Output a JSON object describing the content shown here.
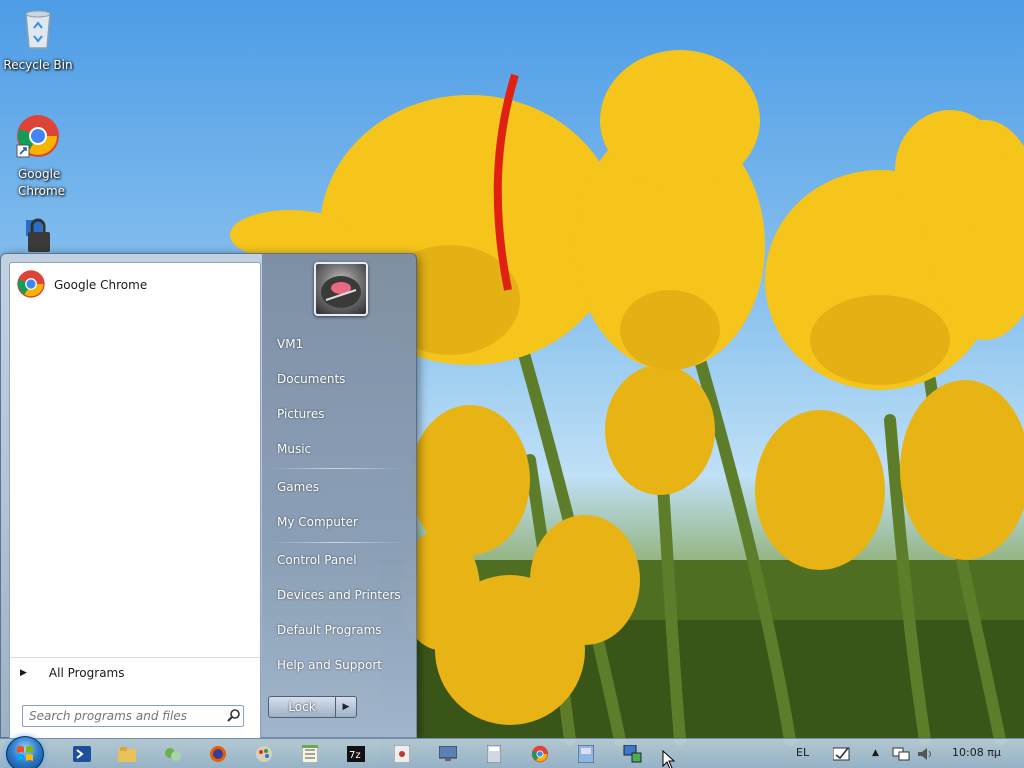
{
  "desktop": {
    "icons": [
      {
        "label": "Recycle Bin",
        "icon": "recycle-bin-icon"
      },
      {
        "label": "Google Chrome",
        "icon": "chrome-icon"
      },
      {
        "label": "",
        "icon": "lock-shortcut-icon"
      }
    ]
  },
  "start_menu": {
    "pinned": [
      {
        "label": "Google Chrome",
        "icon": "chrome-icon"
      }
    ],
    "all_programs_label": "All Programs",
    "search_placeholder": "Search programs and files",
    "user_picture": "user-avatar-icon",
    "right_items": [
      {
        "label": "VM1"
      },
      {
        "label": "Documents"
      },
      {
        "label": "Pictures"
      },
      {
        "label": "Music"
      },
      {
        "label": "Games"
      },
      {
        "label": "My Computer"
      },
      {
        "label": "Control Panel"
      },
      {
        "label": "Devices and Printers"
      },
      {
        "label": "Default Programs"
      },
      {
        "label": "Help and Support"
      }
    ],
    "lock_label": "Lock"
  },
  "taskbar": {
    "apps": [
      {
        "icon": "powershell-icon"
      },
      {
        "icon": "explorer-folder-icon"
      },
      {
        "icon": "network-share-icon"
      },
      {
        "icon": "firefox-icon"
      },
      {
        "icon": "paint-icon"
      },
      {
        "icon": "notepad-icon"
      },
      {
        "icon": "7zip-icon"
      },
      {
        "icon": "media-app-icon"
      },
      {
        "icon": "remote-desktop-icon"
      },
      {
        "icon": "calculator-icon"
      },
      {
        "icon": "chrome-icon"
      },
      {
        "icon": "disk-icon"
      },
      {
        "icon": "network-computer-icon"
      }
    ],
    "tray": {
      "language": "EL",
      "clock": "10:08 πμ"
    }
  },
  "colors": {
    "sky": "#4d9ce6",
    "tulip": "#f2c318",
    "menu_right": "#5f7691",
    "taskbar": "#a8c2dd"
  }
}
